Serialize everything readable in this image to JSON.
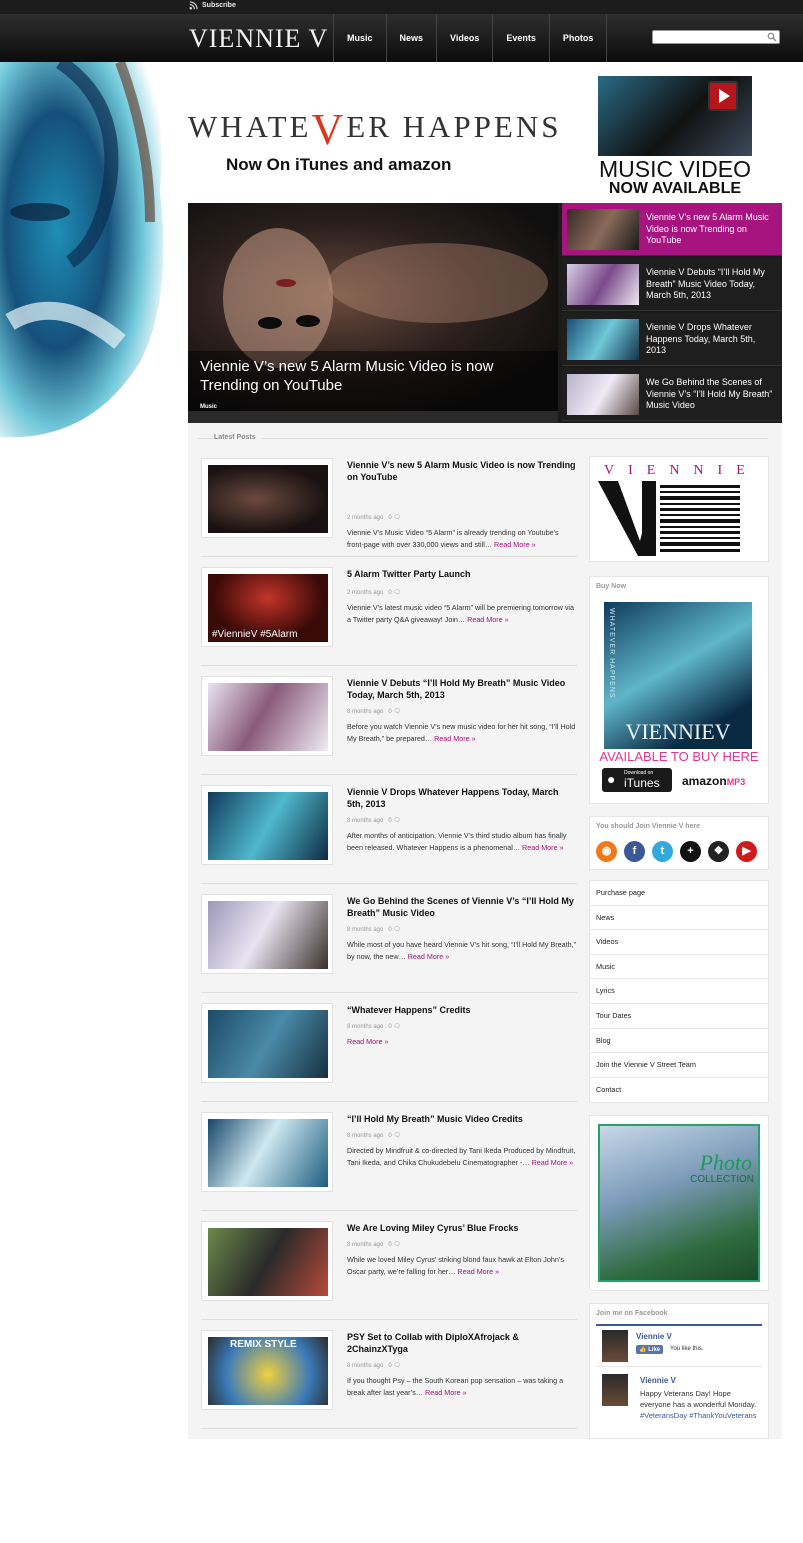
{
  "header": {
    "subscribe_label": "Subscribe",
    "logo_text": "VIENNIE V",
    "nav": [
      "Music",
      "News",
      "Videos",
      "Events",
      "Photos"
    ],
    "search_placeholder": ""
  },
  "banner": {
    "title_pre": "WHATE",
    "title_v": "V",
    "title_post": "ER HAPPENS",
    "subtitle": "Now On  iTunes  and  amazon",
    "promo_line1": "MUSIC VIDEO",
    "promo_line2": "NOW AVAILABLE"
  },
  "slider": {
    "main_title": "Viennie V’s new 5 Alarm Music Video is now Trending on YouTube",
    "main_category": "Music",
    "items": [
      "Viennie V’s new 5 Alarm Music Video is now Trending on YouTube",
      "Viennie V Debuts “I’ll Hold My Breath” Music Video Today, March 5th, 2013",
      "Viennie V Drops Whatever Happens Today, March 5th, 2013",
      "We Go Behind the Scenes of Viennie V’s “I’ll Hold My Breath” Music Video"
    ]
  },
  "latest": {
    "label": "Latest Posts",
    "read_more": "Read More »",
    "posts": [
      {
        "title": "Viennie V’s new 5 Alarm Music Video is now Trending on YouTube",
        "date": "2 months ago",
        "comments": "0",
        "excerpt": "Viennie V’s Music Video “5 Alarm” is already trending on Youtube’s front-page with over 330,000 views and still…"
      },
      {
        "title": "5 Alarm Twitter Party Launch",
        "date": "2 months ago",
        "comments": "0",
        "excerpt": "Viennie V’s latest music video “5 Alarm” will be premiering tomorrow via a Twitter party Q&A giveaway! Join…",
        "thumb_caption": "#ViennieV #5Alarm"
      },
      {
        "title": "Viennie V Debuts “I’ll Hold My Breath” Music Video Today, March 5th, 2013",
        "date": "8 months ago",
        "comments": "0",
        "excerpt": "Before you watch Viennie V’s new music video for her hit song, “I’ll Hold My Breath,” be prepared…"
      },
      {
        "title": "Viennie V Drops Whatever Happens Today, March 5th, 2013",
        "date": "8 months ago",
        "comments": "0",
        "excerpt": "After months of anticipation, Viennie V’s third studio album has finally been released. Whatever Happens is a phenomenal…"
      },
      {
        "title": "We Go Behind the Scenes of Viennie V’s “I’ll Hold My Breath” Music Video",
        "date": "8 months ago",
        "comments": "0",
        "excerpt": "While most of you have heard Viennie V’s hit song, “I’ll Hold My Breath,” by now, the new…"
      },
      {
        "title": "“Whatever Happens” Credits",
        "date": "8 months ago",
        "comments": "0",
        "excerpt": ""
      },
      {
        "title": "“I’ll Hold My Breath” Music Video Credits",
        "date": "8 months ago",
        "comments": "0",
        "excerpt": "Directed by Mindfruit & co-directed by Tani Ikeda Produced by Mindfruit, Tani Ikeda, and Chika Chukudebelu Cinematographer -…"
      },
      {
        "title": "We Are Loving Miley Cyrus’ Blue Frocks",
        "date": "8 months ago",
        "comments": "0",
        "excerpt": "While we loved Miley Cyrus’ striking blond faux hawk at Elton John’s Oscar party, we’re falling for her…"
      },
      {
        "title": "PSY Set to Collab with DiploXAfrojack & 2ChainzXTyga",
        "date": "8 months ago",
        "comments": "0",
        "excerpt": "If you thought Psy – the South Korean pop sensation – was taking a break after last year’s…",
        "thumb_caption": "REMIX STYLE"
      }
    ]
  },
  "sidebar": {
    "logo_text": "VIENNIE",
    "logo_vertical": "VIENNIE",
    "buy_now_title": "Buy Now",
    "album_artist": "VIENNIEV",
    "album_side": "WHATEVER HAPPENS",
    "album_cta": "AVAILABLE TO BUY HERE",
    "itunes_small": "Download on",
    "itunes_label": "iTunes",
    "amazon_label": "amazon",
    "amazon_mp3": "MP3",
    "join_title": "You should Join Viennie V here",
    "social": [
      {
        "name": "rss",
        "color": "#f07a1a",
        "glyph": "◉"
      },
      {
        "name": "facebook",
        "color": "#3b5998",
        "glyph": "f"
      },
      {
        "name": "twitter",
        "color": "#33aadd",
        "glyph": "t"
      },
      {
        "name": "plus",
        "color": "#111111",
        "glyph": "+"
      },
      {
        "name": "myspace",
        "color": "#222222",
        "glyph": "❖"
      },
      {
        "name": "youtube",
        "color": "#d11b1b",
        "glyph": "▶"
      }
    ],
    "menu": [
      "Purchase page",
      "News",
      "Videos",
      "Music",
      "Lyrics",
      "Tour Dates",
      "Blog",
      "Join the Viennie V Street Team",
      "Contact"
    ],
    "photo_word": "Photo",
    "photo_word2": "COLLECTION",
    "fb_title": "Join me on Facebook",
    "fb_page_name": "Viennie V",
    "fb_like_label": "Like",
    "fb_you_like": "You like this.",
    "fb_post_name": "Viennie V",
    "fb_post_text": "Happy Veterans Day! Hope everyone has a wonderful Monday.",
    "fb_post_tags": "#VeteransDay #ThankYouVeterans"
  }
}
